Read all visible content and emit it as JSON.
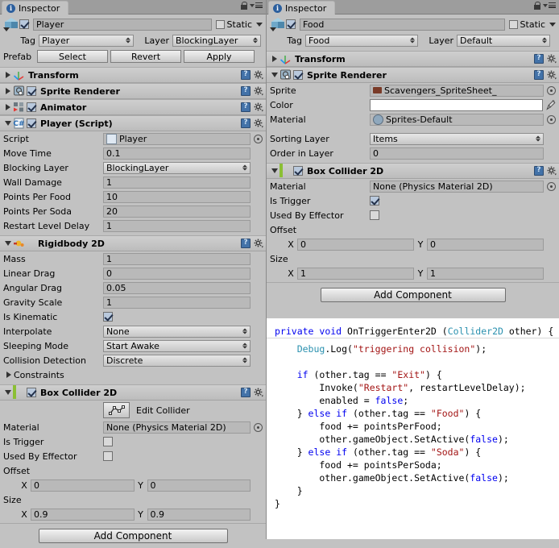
{
  "left": {
    "tab": {
      "label": "Inspector",
      "icon": "info-icon"
    },
    "object": {
      "name": "Player",
      "static_label": "Static",
      "tag_label": "Tag",
      "tag_value": "Player",
      "layer_label": "Layer",
      "layer_value": "BlockingLayer",
      "prefab_label": "Prefab",
      "prefab_buttons": [
        "Select",
        "Revert",
        "Apply"
      ]
    },
    "components": [
      {
        "title": "Transform",
        "icon": "transform-icon",
        "expanded": false,
        "checkbox": null
      },
      {
        "title": "Sprite Renderer",
        "icon": "sprite-renderer-icon",
        "expanded": false,
        "checkbox": true
      },
      {
        "title": "Animator",
        "icon": "animator-icon",
        "expanded": false,
        "checkbox": true
      },
      {
        "title": "Player (Script)",
        "icon": "script-icon",
        "expanded": true,
        "checkbox": true
      },
      {
        "title": "Rigidbody 2D",
        "icon": "rigidbody2d-icon",
        "expanded": true,
        "checkbox": null
      },
      {
        "title": "Box Collider 2D",
        "icon": "boxcollider2d-icon",
        "expanded": true,
        "checkbox": true
      }
    ],
    "player_script": [
      {
        "label": "Script",
        "value": "Player",
        "type": "object"
      },
      {
        "label": "Move Time",
        "value": "0.1",
        "type": "text"
      },
      {
        "label": "Blocking Layer",
        "value": "BlockingLayer",
        "type": "dropdown"
      },
      {
        "label": "Wall Damage",
        "value": "1",
        "type": "text"
      },
      {
        "label": "Points Per Food",
        "value": "10",
        "type": "text"
      },
      {
        "label": "Points Per Soda",
        "value": "20",
        "type": "text"
      },
      {
        "label": "Restart Level Delay",
        "value": "1",
        "type": "text"
      }
    ],
    "rigidbody": [
      {
        "label": "Mass",
        "value": "1",
        "type": "text"
      },
      {
        "label": "Linear Drag",
        "value": "0",
        "type": "text"
      },
      {
        "label": "Angular Drag",
        "value": "0.05",
        "type": "text"
      },
      {
        "label": "Gravity Scale",
        "value": "1",
        "type": "text"
      },
      {
        "label": "Is Kinematic",
        "value": true,
        "type": "checkbox"
      },
      {
        "label": "Interpolate",
        "value": "None",
        "type": "dropdown"
      },
      {
        "label": "Sleeping Mode",
        "value": "Start Awake",
        "type": "dropdown"
      },
      {
        "label": "Collision Detection",
        "value": "Discrete",
        "type": "dropdown"
      }
    ],
    "constraints_label": "Constraints",
    "box_collider": {
      "edit_collider_label": "Edit Collider",
      "material_label": "Material",
      "material_value": "None (Physics Material 2D)",
      "is_trigger_label": "Is Trigger",
      "is_trigger_value": false,
      "used_by_effector_label": "Used By Effector",
      "used_by_effector_value": false,
      "offset_label": "Offset",
      "offset_x_label": "X",
      "offset_x": "0",
      "offset_y_label": "Y",
      "offset_y": "0",
      "size_label": "Size",
      "size_x_label": "X",
      "size_x": "0.9",
      "size_y_label": "Y",
      "size_y": "0.9"
    },
    "add_component": "Add Component"
  },
  "right": {
    "tab": {
      "label": "Inspector",
      "icon": "info-icon"
    },
    "object": {
      "name": "Food",
      "static_label": "Static",
      "tag_label": "Tag",
      "tag_value": "Food",
      "layer_label": "Layer",
      "layer_value": "Default"
    },
    "components": [
      {
        "title": "Transform",
        "icon": "transform-icon",
        "expanded": false,
        "checkbox": null
      },
      {
        "title": "Sprite Renderer",
        "icon": "sprite-renderer-icon",
        "expanded": true,
        "checkbox": true
      },
      {
        "title": "Box Collider 2D",
        "icon": "boxcollider2d-icon",
        "expanded": true,
        "checkbox": true
      }
    ],
    "sprite_renderer": {
      "sprite_label": "Sprite",
      "sprite_value": "Scavengers_SpriteSheet_",
      "color_label": "Color",
      "color_value": "#FFFFFF",
      "material_label": "Material",
      "material_value": "Sprites-Default",
      "sorting_layer_label": "Sorting Layer",
      "sorting_layer_value": "Items",
      "order_in_layer_label": "Order in Layer",
      "order_in_layer_value": "0"
    },
    "box_collider": {
      "material_label": "Material",
      "material_value": "None (Physics Material 2D)",
      "is_trigger_label": "Is Trigger",
      "is_trigger_value": true,
      "used_by_effector_label": "Used By Effector",
      "used_by_effector_value": false,
      "offset_label": "Offset",
      "offset_x_label": "X",
      "offset_x": "0",
      "offset_y_label": "Y",
      "offset_y": "0",
      "size_label": "Size",
      "size_x_label": "X",
      "size_x": "1",
      "size_y_label": "Y",
      "size_y": "1"
    },
    "add_component": "Add Component"
  },
  "code": {
    "signature_line": "private void OnTriggerEnter2D (Collider2D other) {",
    "lines": [
      "",
      "    Debug.Log(\"triggering collision\");",
      "",
      "    if (other.tag == \"Exit\") {",
      "        Invoke(\"Restart\", restartLevelDelay);",
      "        enabled = false;",
      "    } else if (other.tag == \"Food\") {",
      "        food += pointsPerFood;",
      "        other.gameObject.SetActive(false);",
      "    } else if (other.tag == \"Soda\") {",
      "        food += pointsPerSoda;",
      "        other.gameObject.SetActive(false);",
      "    }",
      "}"
    ]
  },
  "colors": {
    "panel_bg": "#c2c2c2",
    "component_header": "#c8c8c8",
    "field_bg": "#b9b9b9",
    "accent_blue": "#2c5f9e",
    "collider_green": "#8bbf34",
    "keyword": "#0000f0",
    "type": "#2b91af",
    "string": "#a31515"
  }
}
